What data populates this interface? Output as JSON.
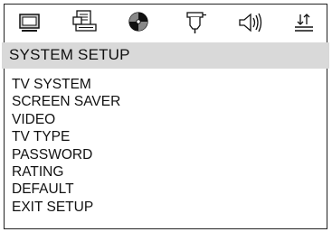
{
  "icons": [
    {
      "name": "tv-monitor-icon"
    },
    {
      "name": "language-page-icon"
    },
    {
      "name": "audio-disc-icon"
    },
    {
      "name": "video-plug-icon"
    },
    {
      "name": "speaker-icon"
    },
    {
      "name": "exit-arrows-icon"
    }
  ],
  "title": "SYSTEM SETUP",
  "menu": {
    "items": [
      {
        "label": "TV  SYSTEM"
      },
      {
        "label": "SCREEN SAVER"
      },
      {
        "label": "VIDEO"
      },
      {
        "label": "TV TYPE"
      },
      {
        "label": "PASSWORD"
      },
      {
        "label": "RATING"
      },
      {
        "label": "DEFAULT"
      },
      {
        "label": "EXIT SETUP"
      }
    ]
  }
}
